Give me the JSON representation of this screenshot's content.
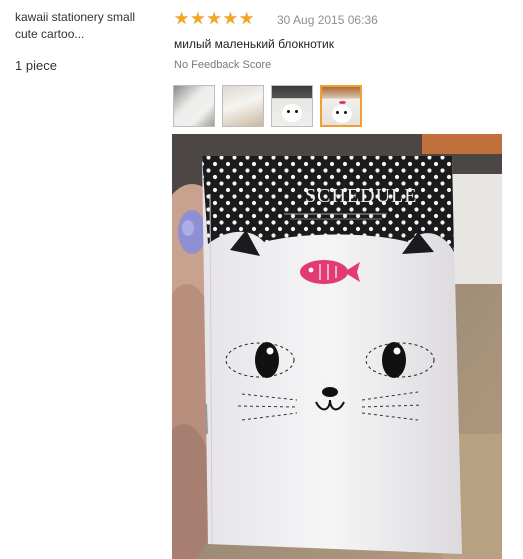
{
  "product": {
    "title_line1": "kawaii stationery small",
    "title_line2": "cute cartoo...",
    "quantity": "1 piece"
  },
  "review": {
    "rating": 5,
    "rating_max": 5,
    "star_color": "#f5a623",
    "date": "30 Aug 2015 06:36",
    "text": "милый маленький блокнотик",
    "feedback": "No Feedback Score",
    "thumbnails": [
      {
        "icon": "notebook-photo"
      },
      {
        "icon": "notebook-photo"
      },
      {
        "icon": "cat-notebook-photo"
      },
      {
        "icon": "cat-notebook-photo",
        "selected": true
      }
    ]
  },
  "photo": {
    "notebook_title": "SCHEDULE"
  }
}
